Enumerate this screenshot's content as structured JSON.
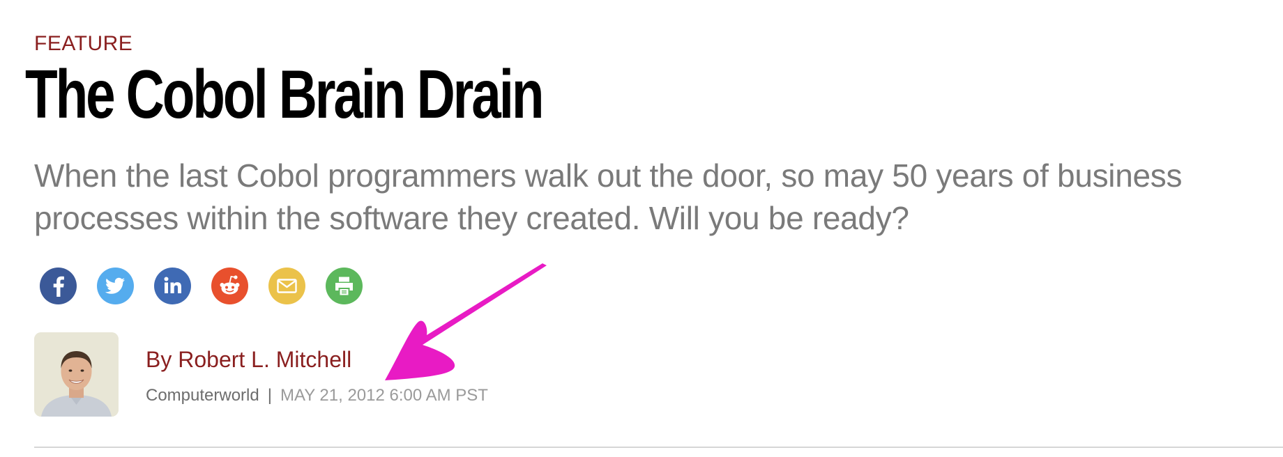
{
  "article": {
    "kicker": "FEATURE",
    "headline": "The Cobol Brain Drain",
    "dek": "When the last Cobol programmers walk out the door, so may 50 years of business processes within the software they created. Will you be ready?",
    "byline": "By Robert L. Mitchell",
    "publication": "Computerworld",
    "separator": "|",
    "date": "MAY 21, 2012 6:00 AM PST"
  },
  "share": [
    {
      "name": "facebook-icon",
      "color": "#3b5998"
    },
    {
      "name": "twitter-icon",
      "color": "#55acee"
    },
    {
      "name": "linkedin-icon",
      "color": "#3f6ab4"
    },
    {
      "name": "reddit-icon",
      "color": "#e8502d"
    },
    {
      "name": "email-icon",
      "color": "#ebc24a"
    },
    {
      "name": "print-icon",
      "color": "#5cb85c"
    }
  ],
  "colors": {
    "kicker": "#8a1f1f",
    "annotation_arrow": "#e81bc4"
  }
}
